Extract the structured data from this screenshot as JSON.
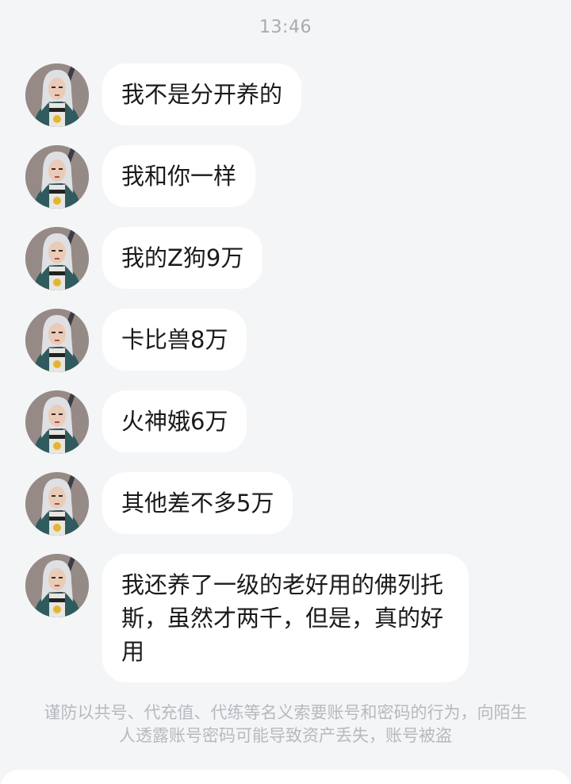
{
  "timestamp": "13:46",
  "messages": [
    {
      "text": "我不是分开养的"
    },
    {
      "text": "我和你一样"
    },
    {
      "text": "我的Z狗9万"
    },
    {
      "text": "卡比兽8万"
    },
    {
      "text": "火神娥6万"
    },
    {
      "text": "其他差不多5万"
    },
    {
      "text": "我还养了一级的老好用的佛列托斯，虽然才两千，但是，真的好用"
    }
  ],
  "notice": "谨防以共号、代充值、代练等名义索要账号和密码的行为，向陌生人透露账号密码可能导致资产丢失，账号被盗",
  "colors": {
    "background": "#f4f5f7",
    "bubble": "#ffffff",
    "text": "#1a1a1a",
    "muted": "#a8abb0"
  }
}
